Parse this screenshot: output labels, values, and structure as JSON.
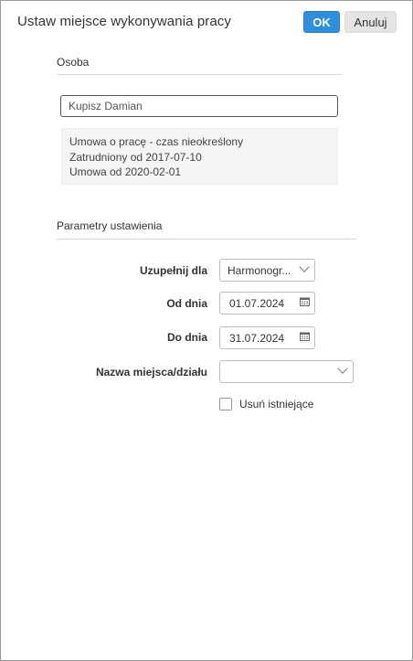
{
  "dialog": {
    "title": "Ustaw miejsce wykonywania pracy",
    "ok_label": "OK",
    "cancel_label": "Anuluj"
  },
  "person_section": {
    "title": "Osoba",
    "person_name": "Kupisz Damian",
    "info_lines": [
      "Umowa o pracę - czas nieokreślony",
      "Zatrudniony od 2017-07-10",
      "Umowa od 2020-02-01"
    ]
  },
  "params_section": {
    "title": "Parametry ustawienia",
    "fill_for_label": "Uzupełnij dla",
    "fill_for_value": "Harmonogr...",
    "from_label": "Od dnia",
    "from_value": "01.07.2024",
    "to_label": "Do dnia",
    "to_value": "31.07.2024",
    "place_label": "Nazwa miejsca/działu",
    "place_value": "",
    "remove_existing_label": "Usuń istniejące",
    "remove_existing_checked": false
  },
  "icons": {
    "calendar": "calendar-icon",
    "dropdown": "chevron-down-icon"
  },
  "colors": {
    "primary_button": "#2f8fdc",
    "secondary_button": "#e4e4e4"
  }
}
